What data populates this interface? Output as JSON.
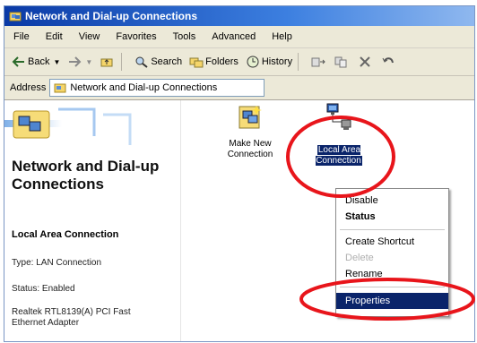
{
  "window": {
    "title": "Network and Dial-up Connections"
  },
  "menubar": {
    "items": [
      "File",
      "Edit",
      "View",
      "Favorites",
      "Tools",
      "Advanced",
      "Help"
    ]
  },
  "toolbar": {
    "back": "Back",
    "search": "Search",
    "folders": "Folders",
    "history": "History"
  },
  "addressbar": {
    "label": "Address",
    "value": "Network and Dial-up Connections"
  },
  "leftpane": {
    "title": "Network and Dial-up Connections",
    "connection_name": "Local Area Connection",
    "type": "Type: LAN Connection",
    "status": "Status: Enabled",
    "adapter": "Realtek RTL8139(A) PCI Fast Ethernet Adapter"
  },
  "icons": {
    "make_new": "Make New Connection",
    "local_area": "Local Area Connection"
  },
  "context_menu": {
    "disable": "Disable",
    "status": "Status",
    "create_shortcut": "Create Shortcut",
    "delete": "Delete",
    "rename": "Rename",
    "properties": "Properties"
  },
  "colors": {
    "titlebar": "#0a3aa6",
    "selection": "#0a246a",
    "annotation": "#e8151b"
  }
}
